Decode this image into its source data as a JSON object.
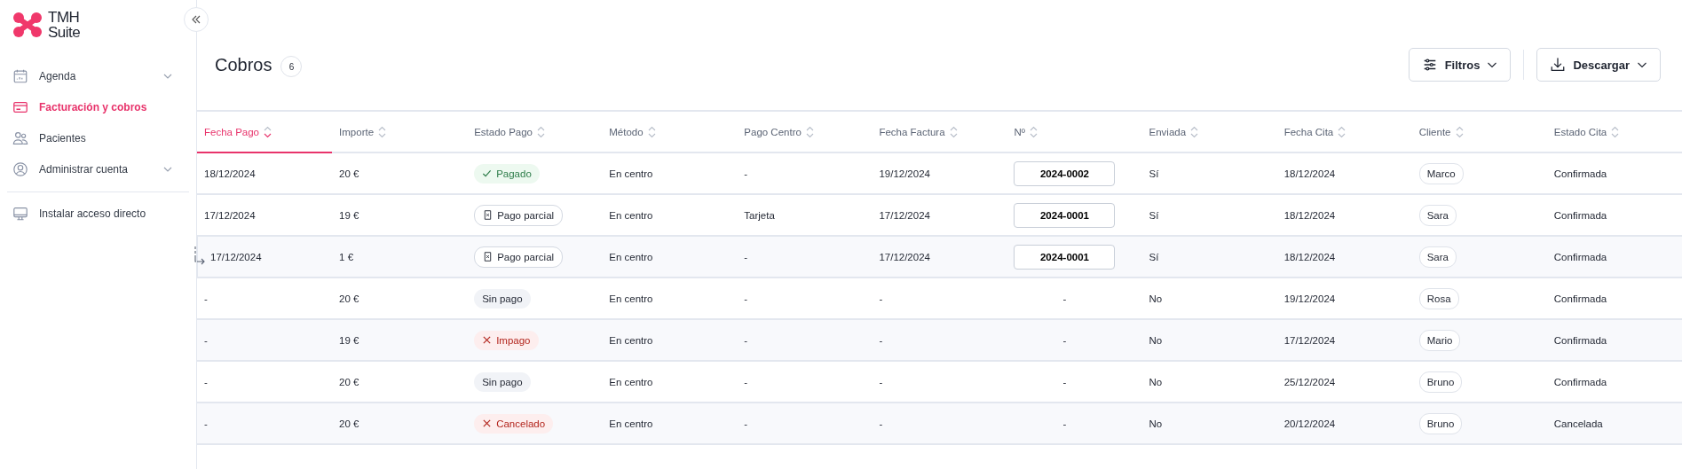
{
  "logo": {
    "line_1": "TMH",
    "line_2": "Suite"
  },
  "sidebar": {
    "items": [
      {
        "label": "Agenda",
        "selected": false,
        "expandable": true
      },
      {
        "label": "Facturación y cobros",
        "selected": true,
        "expandable": false
      },
      {
        "label": "Pacientes",
        "selected": false,
        "expandable": false
      },
      {
        "label": "Administrar cuenta",
        "selected": false,
        "expandable": true
      }
    ],
    "footer_item": {
      "label": "Instalar acceso directo"
    }
  },
  "header": {
    "title": "Cobros",
    "count": "6",
    "buttons": [
      {
        "label": "Filtros"
      },
      {
        "label": "Descargar"
      }
    ]
  },
  "table": {
    "columns": [
      {
        "label": "Fecha Pago",
        "selected": true
      },
      {
        "label": "Importe",
        "selected": false
      },
      {
        "label": "Estado Pago",
        "selected": false
      },
      {
        "label": "Método",
        "selected": false
      },
      {
        "label": "Pago Centro",
        "selected": false
      },
      {
        "label": "Fecha Factura",
        "selected": false
      },
      {
        "label": "Nº",
        "selected": false
      },
      {
        "label": "Enviada",
        "selected": false
      },
      {
        "label": "Fecha Cita",
        "selected": false
      },
      {
        "label": "Cliente",
        "selected": false
      },
      {
        "label": "Estado Cita",
        "selected": false
      }
    ],
    "rows": [
      {
        "child": false,
        "shaded": false,
        "fecha_pago": "18/12/2024",
        "importe": "20 €",
        "estado_pago": {
          "kind": "paid",
          "label": "Pagado"
        },
        "metodo": "En centro",
        "pago_centro": "-",
        "fecha_factura": "19/12/2024",
        "numero": "2024-0002",
        "enviada": "Sí",
        "fecha_cita": "18/12/2024",
        "cliente": "Marco",
        "estado_cita": "Confirmada"
      },
      {
        "child": false,
        "shaded": false,
        "fecha_pago": "17/12/2024",
        "importe": "19 €",
        "estado_pago": {
          "kind": "partial",
          "label": "Pago parcial"
        },
        "metodo": "En centro",
        "pago_centro": "Tarjeta",
        "fecha_factura": "17/12/2024",
        "numero": "2024-0001",
        "enviada": "Sí",
        "fecha_cita": "18/12/2024",
        "cliente": "Sara",
        "estado_cita": "Confirmada"
      },
      {
        "child": true,
        "shaded": true,
        "fecha_pago": "17/12/2024",
        "importe": "1 €",
        "estado_pago": {
          "kind": "partial",
          "label": "Pago parcial"
        },
        "metodo": "En centro",
        "pago_centro": "-",
        "fecha_factura": "17/12/2024",
        "numero": "2024-0001",
        "enviada": "Sí",
        "fecha_cita": "18/12/2024",
        "cliente": "Sara",
        "estado_cita": "Confirmada"
      },
      {
        "child": false,
        "shaded": false,
        "fecha_pago": "-",
        "importe": "20 €",
        "estado_pago": {
          "kind": "none",
          "label": "Sin pago"
        },
        "metodo": "En centro",
        "pago_centro": "-",
        "fecha_factura": "-",
        "numero": "-",
        "enviada": "No",
        "fecha_cita": "19/12/2024",
        "cliente": "Rosa",
        "estado_cita": "Confirmada"
      },
      {
        "child": false,
        "shaded": true,
        "fecha_pago": "-",
        "importe": "19 €",
        "estado_pago": {
          "kind": "unpaid",
          "label": "Impago"
        },
        "metodo": "En centro",
        "pago_centro": "-",
        "fecha_factura": "-",
        "numero": "-",
        "enviada": "No",
        "fecha_cita": "17/12/2024",
        "cliente": "Mario",
        "estado_cita": "Confirmada"
      },
      {
        "child": false,
        "shaded": false,
        "fecha_pago": "-",
        "importe": "20 €",
        "estado_pago": {
          "kind": "none",
          "label": "Sin pago"
        },
        "metodo": "En centro",
        "pago_centro": "-",
        "fecha_factura": "-",
        "numero": "-",
        "enviada": "No",
        "fecha_cita": "25/12/2024",
        "cliente": "Bruno",
        "estado_cita": "Confirmada"
      },
      {
        "child": false,
        "shaded": true,
        "fecha_pago": "-",
        "importe": "20 €",
        "estado_pago": {
          "kind": "cancelled",
          "label": "Cancelado"
        },
        "metodo": "En centro",
        "pago_centro": "-",
        "fecha_factura": "-",
        "numero": "-",
        "enviada": "No",
        "fecha_cita": "20/12/2024",
        "cliente": "Bruno",
        "estado_cita": "Cancelada"
      }
    ]
  }
}
